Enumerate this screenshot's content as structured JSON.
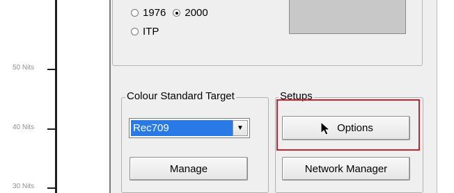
{
  "chart": {
    "labels": [
      "50 Nits",
      "40 Nits",
      "30 Nits"
    ]
  },
  "upper_group": {
    "options": [
      "1976",
      "2000",
      "ITP"
    ],
    "selected": "2000"
  },
  "colour_target": {
    "title": "Colour Standard Target",
    "selected_value": "Rec709",
    "manage_label": "Manage"
  },
  "setups": {
    "title": "Setups",
    "options_label": "Options",
    "network_label": "Network Manager"
  },
  "colors": {
    "accent": "#2979e6",
    "highlight": "#c0282d"
  },
  "icons": [
    "cursor-arrow-icon",
    "chevron-down-icon"
  ]
}
